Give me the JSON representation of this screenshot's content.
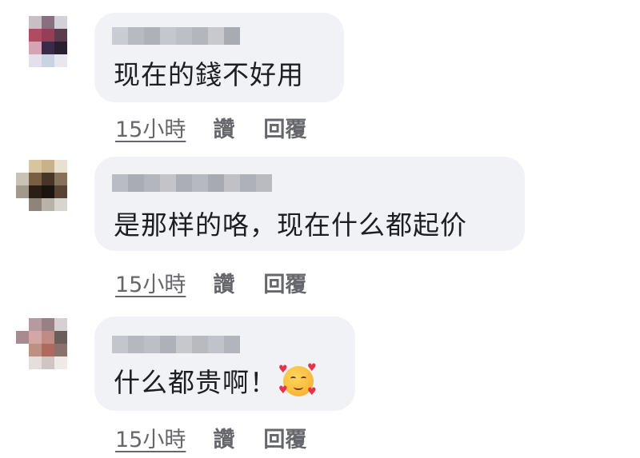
{
  "comments": [
    {
      "text": "现在的錢不好用",
      "time": "15小時",
      "like_label": "讚",
      "reply_label": "回覆",
      "avatar_colors": [
        "#ffffff",
        "#c8bfc4",
        "#8b6f7f",
        "#d4d0d8",
        "#ffffff",
        "#ffffff",
        "#b54a63",
        "#9e3b58",
        "#5d3b4f",
        "#ffffff",
        "#ffffff",
        "#d9a3b4",
        "#3d2a4a",
        "#2a1f33",
        "#ffffff",
        "#ffffff",
        "#e4e0ea",
        "#c9d3e5",
        "#e7e7ee",
        "#ffffff",
        "#ffffff",
        "#ffffff",
        "#ffffff",
        "#ffffff",
        "#ffffff"
      ],
      "name_colors": [
        "#c9ccd3",
        "#b7bac1",
        "#aeb1b8",
        "#c4c7cd",
        "#bdbfc6",
        "#b3b6bd",
        "#c7c9cf",
        "#a8abb2"
      ]
    },
    {
      "text": "是那样的咯，现在什么都起价",
      "time": "15小時",
      "like_label": "讚",
      "reply_label": "回覆",
      "avatar_colors": [
        "#ffffff",
        "#d8c59a",
        "#c9b287",
        "#e9e1cd",
        "#ffffff",
        "#c8c3b6",
        "#7a5f3f",
        "#4a3524",
        "#8a7158",
        "#ffffff",
        "#a3998c",
        "#2b1e15",
        "#1d140e",
        "#5a4433",
        "#ffffff",
        "#ffffff",
        "#8f8478",
        "#b9b2a8",
        "#d8d4cd",
        "#ffffff",
        "#ffffff",
        "#ffffff",
        "#ffffff",
        "#ffffff",
        "#ffffff"
      ],
      "name_colors": [
        "#b9bcc3",
        "#a9acb3",
        "#b3b6bc",
        "#c2c4ca",
        "#abaeb5",
        "#b6b9bf",
        "#a7aab1",
        "#bfc1c7",
        "#aeb1b7",
        "#b9bbc1"
      ]
    },
    {
      "text": "什么都贵啊！",
      "emoji": "smiling-face-with-hearts",
      "time": "15小時",
      "like_label": "讚",
      "reply_label": "回覆",
      "avatar_colors": [
        "#ffffff",
        "#b79aa0",
        "#9a7f86",
        "#d9cfd1",
        "#ffffff",
        "#a98a8f",
        "#d8a6a5",
        "#c58a80",
        "#6b5d5a",
        "#ffffff",
        "#ffffff",
        "#c28f7e",
        "#b5685b",
        "#8f6f6a",
        "#ffffff",
        "#ffffff",
        "#e6dedc",
        "#d0c6c4",
        "#efe9e8",
        "#ffffff",
        "#ffffff",
        "#ffffff",
        "#ffffff",
        "#ffffff",
        "#ffffff"
      ],
      "name_colors": [
        "#c3c6cc",
        "#b5b8be",
        "#bcbfc5",
        "#aeb1b7",
        "#c6c8ce",
        "#b8bac0",
        "#c0c3c9",
        "#b2b5bb"
      ]
    }
  ]
}
